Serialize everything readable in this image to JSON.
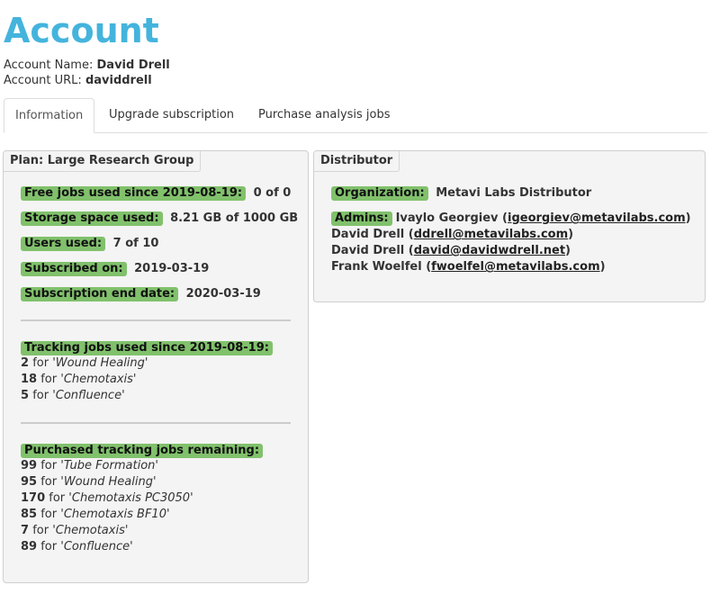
{
  "page": {
    "title": "Account",
    "account_name_label": "Account Name:",
    "account_name": "David Drell",
    "account_url_label": "Account URL:",
    "account_url": "daviddrell"
  },
  "tabs": [
    {
      "label": "Information",
      "active": true
    },
    {
      "label": "Upgrade subscription",
      "active": false
    },
    {
      "label": "Purchase analysis jobs",
      "active": false
    }
  ],
  "plan": {
    "legend": "Plan: Large Research Group",
    "fields": [
      {
        "label": "Free jobs used since 2019-08-19:",
        "value": "0 of 0"
      },
      {
        "label": "Storage space used:",
        "value": "8.21 GB of 1000 GB"
      },
      {
        "label": "Users used:",
        "value": "7 of 10"
      },
      {
        "label": "Subscribed on:",
        "value": "2019-03-19"
      },
      {
        "label": "Subscription end date:",
        "value": "2020-03-19"
      }
    ],
    "tracking_used": {
      "label": "Tracking jobs used since 2019-08-19:",
      "items": [
        {
          "count": "2",
          "for": "for",
          "name": "Wound Healing"
        },
        {
          "count": "18",
          "for": "for",
          "name": "Chemotaxis"
        },
        {
          "count": "5",
          "for": "for",
          "name": "Confluence"
        }
      ]
    },
    "tracking_remaining": {
      "label": "Purchased tracking jobs remaining:",
      "items": [
        {
          "count": "99",
          "for": "for",
          "name": "Tube Formation"
        },
        {
          "count": "95",
          "for": "for",
          "name": "Wound Healing"
        },
        {
          "count": "170",
          "for": "for",
          "name": "Chemotaxis PC3050"
        },
        {
          "count": "85",
          "for": "for",
          "name": "Chemotaxis BF10"
        },
        {
          "count": "7",
          "for": "for",
          "name": "Chemotaxis"
        },
        {
          "count": "89",
          "for": "for",
          "name": "Confluence"
        }
      ]
    }
  },
  "distributor": {
    "legend": "Distributor",
    "organization_label": "Organization:",
    "organization": "Metavi Labs Distributor",
    "admins_label": "Admins:",
    "admins": [
      {
        "name": "Ivaylo Georgiev",
        "email": "igeorgiev@metavilabs.com"
      },
      {
        "name": "David Drell",
        "email": "ddrell@metavilabs.com"
      },
      {
        "name": "David Drell",
        "email": "david@davidwdrell.net"
      },
      {
        "name": "Frank Woelfel",
        "email": "fwoelfel@metavilabs.com"
      }
    ]
  },
  "colors": {
    "title": "#44b4dd",
    "tag_background": "#81c16c",
    "panel_background": "#f4f4f4"
  }
}
